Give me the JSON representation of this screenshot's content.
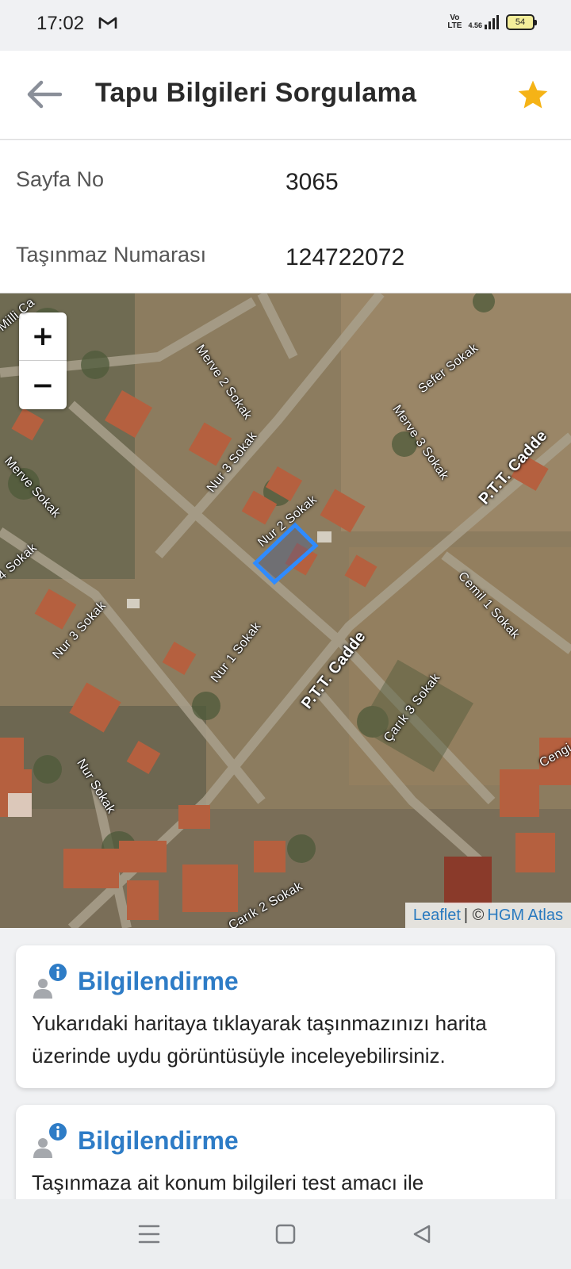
{
  "status": {
    "time": "17:02",
    "volte": "Vo\nLTE",
    "net_speed": "4.56",
    "battery": "54"
  },
  "header": {
    "title": "Tapu Bilgileri Sorgulama",
    "back_icon": "arrow-left-icon",
    "favorite_icon": "star-icon",
    "accent": "#f5b316"
  },
  "fields": [
    {
      "label": "Sayfa No",
      "value": "3065"
    },
    {
      "label": "Taşınmaz Numarası",
      "value": "124722072"
    }
  ],
  "map": {
    "zoom_in": "+",
    "zoom_out": "−",
    "streets": [
      "Merve 2 Sokak",
      "Sefer Sokak",
      "Merve 3 Sokak",
      "P.T.T. Cadde",
      "Nur 3 Sokak",
      "Merve Sokak",
      "Nur 2 Sokak",
      "4 Sokak",
      "Cemil 1 Sokak",
      "Nur 3 Sokak",
      "Nur 1 Sokak",
      "P.T.T. Cadde",
      "Çarık 3 Sokak",
      "Nur Sokak",
      "Cengi",
      "Çarık 2 Sokak",
      "Milli Ca"
    ],
    "attribution": {
      "leaflet": "Leaflet",
      "separator": "| ©",
      "provider": "HGM Atlas"
    },
    "parcel_color": "#2f8bff"
  },
  "cards": [
    {
      "title": "Bilgilendirme",
      "text": "Yukarıdaki haritaya tıklayarak taşınmazınızı harita üzerinde uydu görüntüsüyle inceleyebilirsiniz."
    },
    {
      "title": "Bilgilendirme",
      "text": "Taşınmaza ait konum bilgileri test amacı ile"
    }
  ],
  "nav": {
    "menu_icon": "menu-icon",
    "home_icon": "home-square-icon",
    "back_icon": "back-triangle-icon"
  }
}
